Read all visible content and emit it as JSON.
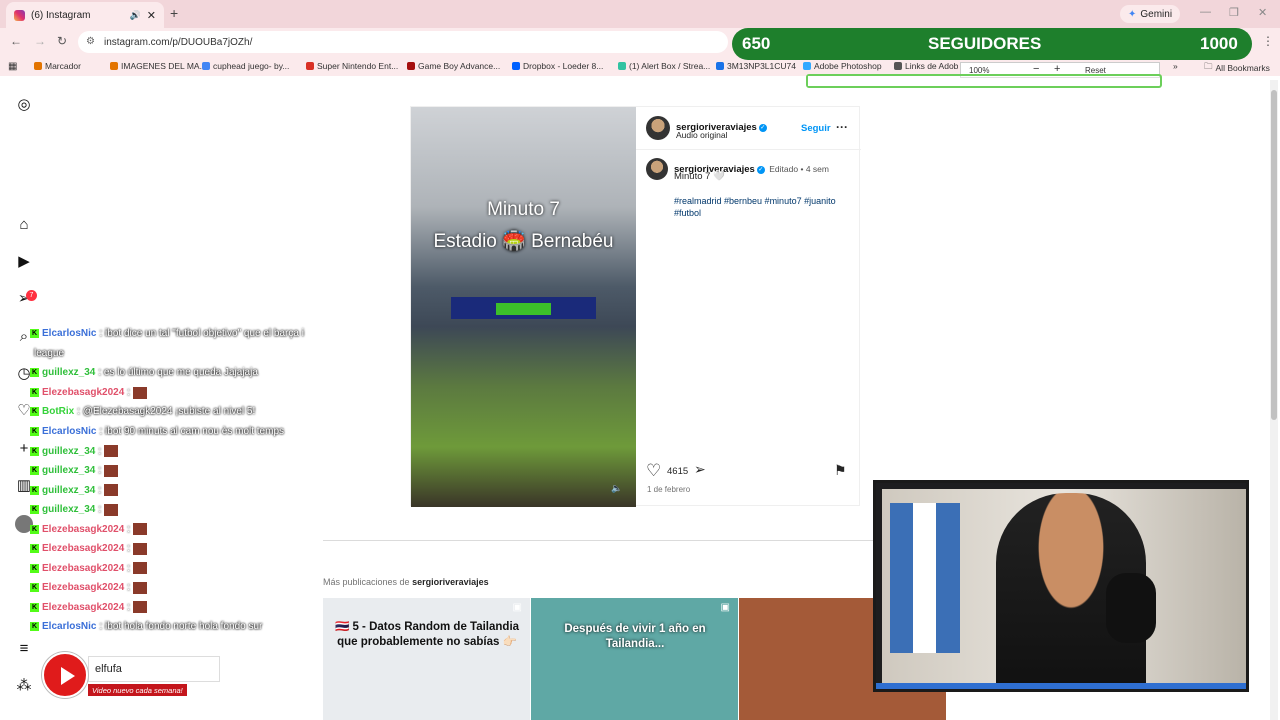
{
  "browser": {
    "tab_title": "(6) Instagram",
    "new_tab": "+",
    "gemini_label": "Gemini",
    "url": "instagram.com/p/DUOUBa7jOZh/",
    "bookmarks": [
      {
        "label": "Marcador",
        "color": "#e37400"
      },
      {
        "label": "IMAGENES DEL MA...",
        "color": "#e37400"
      },
      {
        "label": "cuphead juego- by...",
        "color": "#4285f4"
      },
      {
        "label": "Super Nintendo Ent...",
        "color": "#d93025"
      },
      {
        "label": "Game Boy Advance...",
        "color": "#a50e0e"
      },
      {
        "label": "Dropbox - Loeder 8...",
        "color": "#0061ff"
      },
      {
        "label": "(1) Alert Box / Strea...",
        "color": "#31c3a2"
      },
      {
        "label": "3M13NP3L1CU74",
        "color": "#1a73e8"
      },
      {
        "label": "Adobe Photoshop",
        "color": "#31a8ff"
      },
      {
        "label": "Links de Adob",
        "color": "#555555"
      }
    ],
    "all_bookmarks": "All Bookmarks",
    "zoom": {
      "value": "100%",
      "reset": "Reset",
      "minus": "−",
      "plus": "+"
    }
  },
  "overlay": {
    "followers_current": "650",
    "followers_label": "SEGUIDORES",
    "followers_goal": "1000",
    "progress_fraction": 0.2
  },
  "post": {
    "video_text_line1": "Minuto 7",
    "video_text_line2": "Estadio 🏟️ Bernabéu",
    "author": "sergioriveraviajes",
    "audio": "Audio original",
    "follow": "Seguir",
    "more": "···",
    "caption_author": "sergioriveraviajes",
    "edited": "Editado",
    "ago": "4 sem",
    "caption": "Minuto 7 🤍",
    "hashtags_line1": "#realmadrid #bernbeu #minuto7 #juanito",
    "hashtags_line2": "#futbol",
    "likes": "4615",
    "date": "1 de febrero"
  },
  "more_posts": {
    "label": "Más publicaciones de",
    "user": "sergioriveraviajes",
    "tiles": [
      {
        "caption": "🇹🇭 5 - Datos Random de Tailandia que probablemente no sabías 👉🏻",
        "bg": "#e9ecef"
      },
      {
        "caption": "Después de vivir 1 año en Tailandia...",
        "bg": "#5fa8a5"
      },
      {
        "caption": "",
        "bg": "#a45a38"
      }
    ]
  },
  "chat": [
    {
      "user": "ElcarlosNic",
      "color": "#3a6fd8",
      "msg": ": ibot dice un tal \"futbol objetivo\" que el barça i"
    },
    {
      "user": "",
      "color": "#3a6fd8",
      "msg": "league"
    },
    {
      "user": "guillexz_34",
      "color": "#2fbf3a",
      "msg": ": es lo último que me queda Jajajaja"
    },
    {
      "user": "Elezebasagk2024",
      "color": "#e0506a",
      "msg": ":",
      "emote": true
    },
    {
      "user": "BotRix",
      "color": "#35d23a",
      "msg": ": @Elezebasagk2024 ¡subiste al nivel 5!"
    },
    {
      "user": "ElcarlosNic",
      "color": "#3a6fd8",
      "msg": ": ibot 90 minuts al cam nou ès molt temps"
    },
    {
      "user": "guillexz_34",
      "color": "#2fbf3a",
      "msg": ":",
      "emote": true
    },
    {
      "user": "guillexz_34",
      "color": "#2fbf3a",
      "msg": ":",
      "emote": true
    },
    {
      "user": "guillexz_34",
      "color": "#2fbf3a",
      "msg": ":",
      "emote": true
    },
    {
      "user": "guillexz_34",
      "color": "#2fbf3a",
      "msg": ":",
      "emote": true
    },
    {
      "user": "Elezebasagk2024",
      "color": "#e0506a",
      "msg": ":",
      "emote": true
    },
    {
      "user": "Elezebasagk2024",
      "color": "#e0506a",
      "msg": ":",
      "emote": true
    },
    {
      "user": "Elezebasagk2024",
      "color": "#e0506a",
      "msg": ":",
      "emote": true
    },
    {
      "user": "Elezebasagk2024",
      "color": "#e0506a",
      "msg": ":",
      "emote": true
    },
    {
      "user": "Elezebasagk2024",
      "color": "#e0506a",
      "msg": ":",
      "emote": true
    },
    {
      "user": "ElcarlosNic",
      "color": "#3a6fd8",
      "msg": ": ibot hola fondo norte hola fondo sur"
    }
  ],
  "notifications_badge": "7",
  "youtube": {
    "name": "elfufa",
    "tagline": "Video nuevo cada semana!"
  }
}
